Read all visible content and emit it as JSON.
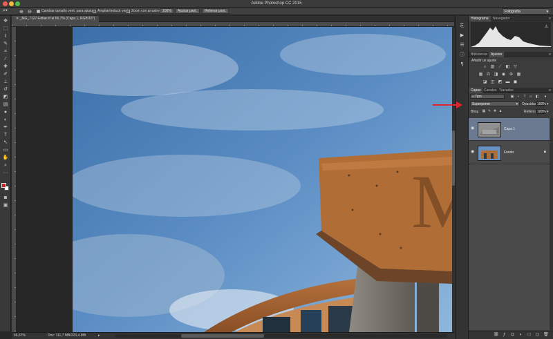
{
  "window": {
    "title": "Adobe Photoshop CC 2015"
  },
  "options_bar": {
    "zoom_in_icon": "zoom-in-icon",
    "zoom_out_icon": "zoom-out-icon",
    "resize_windows_label": "Cambiar tamaño vent. para ajustar",
    "resize_windows_checked": true,
    "zoom_all_windows_label": "Ampliar/reducir vent.",
    "zoom_all_windows_checked": false,
    "scrubby_zoom_label": "Zoom con arrastre",
    "scrubby_zoom_checked": false,
    "btn_100": "100%",
    "btn_fit": "Ajustar pant.",
    "btn_fill": "Rellenar pant.",
    "workspace": "Fotografía"
  },
  "document": {
    "tab_title": "_MG_7127-Editar.tif al 66,7% (Capa 1, RGB/16*)",
    "zoom": "66,67%",
    "doc_info": "Doc: 111,7 MB/223,4 MB"
  },
  "panels": {
    "top_tabs": [
      {
        "label": "Histograma",
        "active": true
      },
      {
        "label": "Navegador",
        "active": false
      }
    ],
    "mid_tabs": [
      {
        "label": "Bibliotecas",
        "active": false
      },
      {
        "label": "Ajustes",
        "active": true
      }
    ],
    "adjustments_title": "Añadir un ajuste",
    "layer_tabs": [
      {
        "label": "Capas",
        "active": true
      },
      {
        "label": "Canales",
        "active": false
      },
      {
        "label": "Trazados",
        "active": false
      }
    ],
    "filter_kind": "Tipo",
    "blend_mode": "Superponer",
    "opacity_label": "Opacidad:",
    "opacity_value": "100%",
    "lock_label": "Bloq.:",
    "fill_label": "Relleno:",
    "fill_value": "100%",
    "layers": [
      {
        "name": "Capa 1",
        "selected": true,
        "locked": false
      },
      {
        "name": "Fondo",
        "selected": false,
        "locked": true
      }
    ]
  },
  "colors": {
    "foreground": "#d0201e",
    "background": "#ffffff",
    "selection": "#6b7a90",
    "annotation_arrow": "#e0262b"
  }
}
